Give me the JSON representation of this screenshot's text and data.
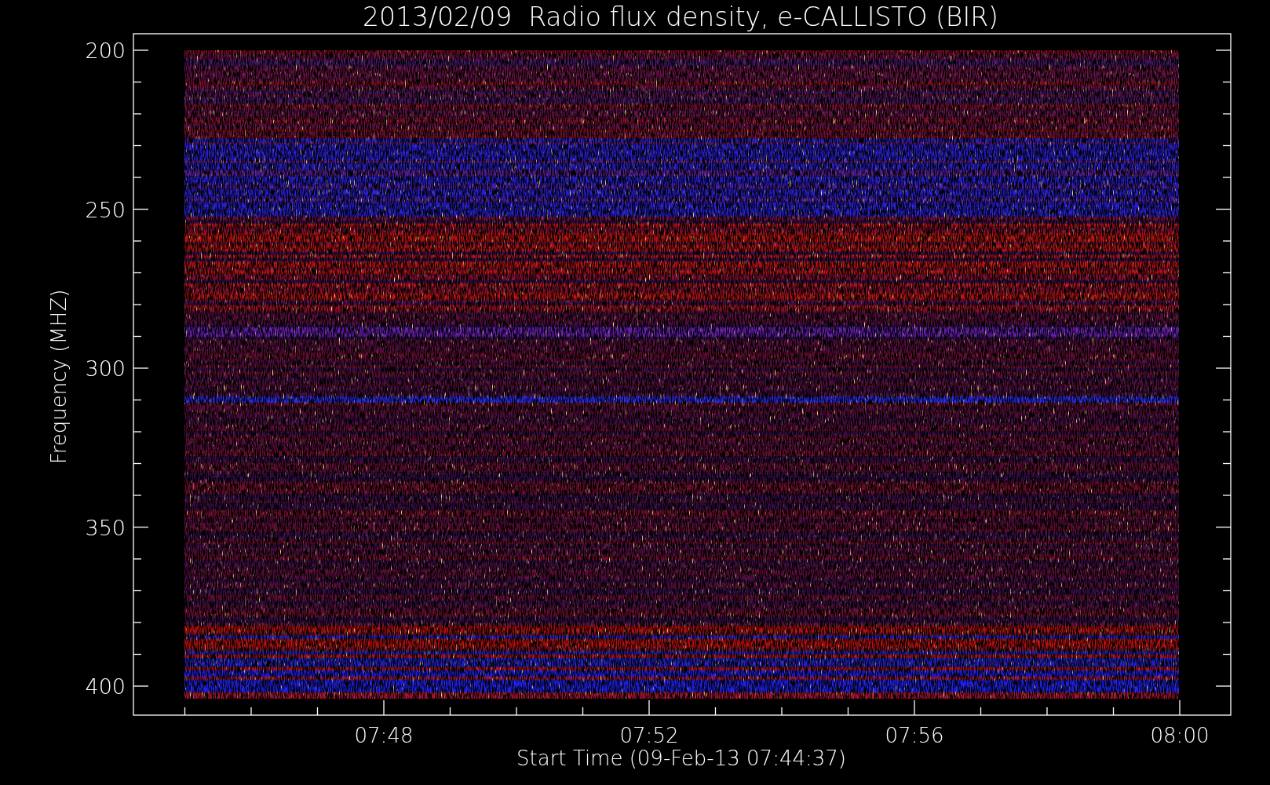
{
  "title": "2013/02/09  Radio flux density, e-CALLISTO (BIR)",
  "ylabel": "Frequency (MHZ)",
  "yticks": [
    "200",
    "250",
    "300",
    "350",
    "400"
  ],
  "xticks": [
    "07:48",
    "07:52",
    "07:56",
    "08:00"
  ],
  "xlabel": "Start Time (09-Feb-13 07:44:37)"
}
